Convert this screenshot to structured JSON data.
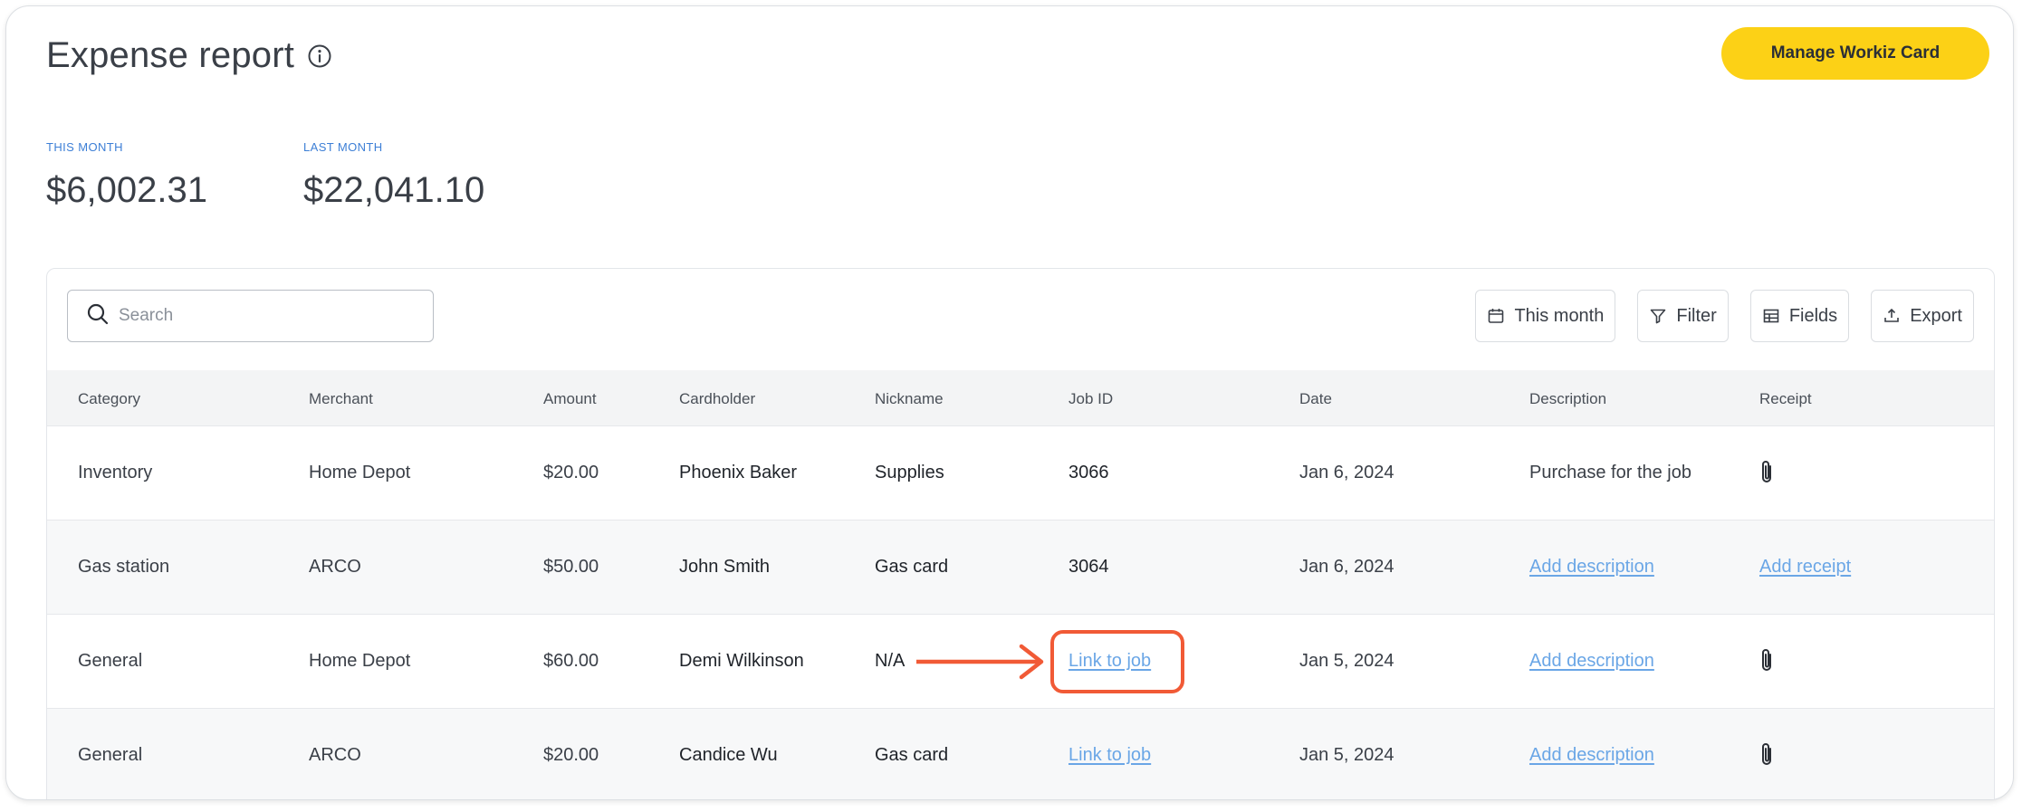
{
  "header": {
    "title": "Expense report",
    "manage_button": "Manage Workiz Card"
  },
  "stats": {
    "this_month": {
      "label": "THIS MONTH",
      "value": "$6,002.31"
    },
    "last_month": {
      "label": "LAST MONTH",
      "value": "$22,041.10"
    }
  },
  "search": {
    "placeholder": "Search"
  },
  "toolbar": {
    "date_range": "This month",
    "filter": "Filter",
    "fields": "Fields",
    "export": "Export"
  },
  "table": {
    "columns": [
      "Category",
      "Merchant",
      "Amount",
      "Cardholder",
      "Nickname",
      "Job ID",
      "Date",
      "Description",
      "Receipt"
    ],
    "rows": [
      {
        "category": "Inventory",
        "merchant": "Home Depot",
        "amount": "$20.00",
        "cardholder": "Phoenix Baker",
        "nickname": "Supplies",
        "job_id": "3066",
        "date": "Jan 6, 2024",
        "description": "Purchase for the job",
        "receipt": "attachment"
      },
      {
        "category": "Gas station",
        "merchant": "ARCO",
        "amount": "$50.00",
        "cardholder": "John Smith",
        "nickname": "Gas card",
        "job_id": "3064",
        "date": "Jan 6, 2024",
        "description": "Add description",
        "receipt": "Add receipt"
      },
      {
        "category": "General",
        "merchant": "Home Depot",
        "amount": "$60.00",
        "cardholder": "Demi Wilkinson",
        "nickname": "N/A",
        "job_id": "Link to job",
        "date": "Jan 5, 2024",
        "description": "Add description",
        "receipt": "attachment"
      },
      {
        "category": "General",
        "merchant": "ARCO",
        "amount": "$20.00",
        "cardholder": "Candice Wu",
        "nickname": "Gas card",
        "job_id": "Link to job",
        "date": "Jan 5, 2024",
        "description": "Add description",
        "receipt": "attachment"
      }
    ]
  },
  "annotation": {
    "color": "#f15a36"
  },
  "icons": {
    "title_info": "info-icon",
    "search": "search-icon",
    "date": "calendar-icon",
    "filter": "funnel-icon",
    "fields": "table-grid-icon",
    "export": "upload-icon",
    "receipt": "paperclip-icon"
  },
  "colors": {
    "accent": "#fcd116",
    "link": "#6aa6e6",
    "label": "#3d7fd6"
  }
}
